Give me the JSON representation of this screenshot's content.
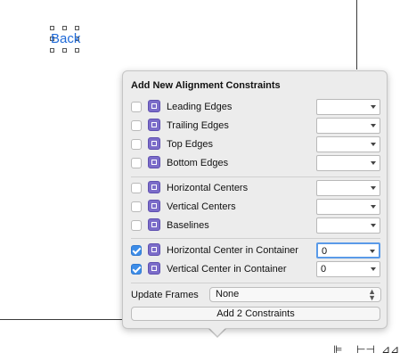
{
  "canvas": {
    "back_label": "Back"
  },
  "popover": {
    "title": "Add New Alignment Constraints",
    "rows": [
      {
        "label": "Leading Edges",
        "checked": false,
        "value": ""
      },
      {
        "label": "Trailing Edges",
        "checked": false,
        "value": ""
      },
      {
        "label": "Top Edges",
        "checked": false,
        "value": ""
      },
      {
        "label": "Bottom Edges",
        "checked": false,
        "value": ""
      },
      {
        "label": "Horizontal Centers",
        "checked": false,
        "value": ""
      },
      {
        "label": "Vertical Centers",
        "checked": false,
        "value": ""
      },
      {
        "label": "Baselines",
        "checked": false,
        "value": ""
      },
      {
        "label": "Horizontal Center in Container",
        "checked": true,
        "value": "0"
      },
      {
        "label": "Vertical Center in Container",
        "checked": true,
        "value": "0"
      }
    ],
    "update_frames_label": "Update Frames",
    "update_frames_value": "None",
    "add_button_label": "Add 2 Constraints"
  },
  "toolbar": {
    "icons": [
      "align-icon",
      "pin-icon",
      "resolve-issues-icon"
    ]
  },
  "colors": {
    "accent": "#3d8de8",
    "link": "#1f6ad8",
    "constraint_icon": "#7b6cc9"
  }
}
